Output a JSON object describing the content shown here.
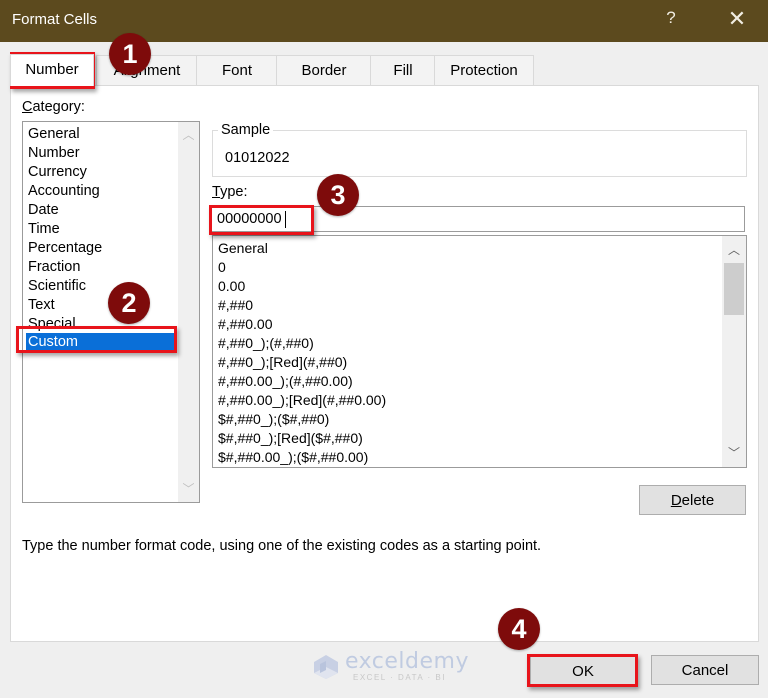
{
  "window": {
    "title": "Format Cells",
    "help_label": "?",
    "close_label": "✕",
    "colors": {
      "titlebar": "#5c4a1e",
      "selection": "#0a6fd8",
      "highlight_box": "#e8141b",
      "badge": "#7e0b0b"
    }
  },
  "tabs": [
    {
      "label": "Number",
      "active": true
    },
    {
      "label": "Alignment",
      "active": false
    },
    {
      "label": "Font",
      "active": false
    },
    {
      "label": "Border",
      "active": false
    },
    {
      "label": "Fill",
      "active": false
    },
    {
      "label": "Protection",
      "active": false
    }
  ],
  "category": {
    "label_accel": "C",
    "label_rest": "ategory:",
    "items": [
      "General",
      "Number",
      "Currency",
      "Accounting",
      "Date",
      "Time",
      "Percentage",
      "Fraction",
      "Scientific",
      "Text",
      "Special",
      "Custom"
    ],
    "selected": "Custom"
  },
  "sample": {
    "label": "Sample",
    "value": "01012022"
  },
  "type": {
    "label_accel": "T",
    "label_rest": "ype:",
    "value": "00000000"
  },
  "format_codes": [
    "General",
    "0",
    "0.00",
    "#,##0",
    "#,##0.00",
    "#,##0_);(#,##0)",
    "#,##0_);[Red](#,##0)",
    "#,##0.00_);(#,##0.00)",
    "#,##0.00_);[Red](#,##0.00)",
    "$#,##0_);($#,##0)",
    "$#,##0_);[Red]($#,##0)",
    "$#,##0.00_);($#,##0.00)"
  ],
  "buttons": {
    "delete_accel": "D",
    "delete_rest": "elete",
    "ok": "OK",
    "cancel": "Cancel"
  },
  "description": "Type the number format code, using one of the existing codes as a starting point.",
  "annotations": {
    "step1": "1",
    "step2": "2",
    "step3": "3",
    "step4": "4"
  },
  "watermark": {
    "name": "exceldemy",
    "tagline": "EXCEL · DATA · BI"
  },
  "icons": {
    "scroll_up": "chevron-up-icon",
    "scroll_down": "chevron-down-icon",
    "close": "close-icon",
    "help": "help-icon"
  }
}
